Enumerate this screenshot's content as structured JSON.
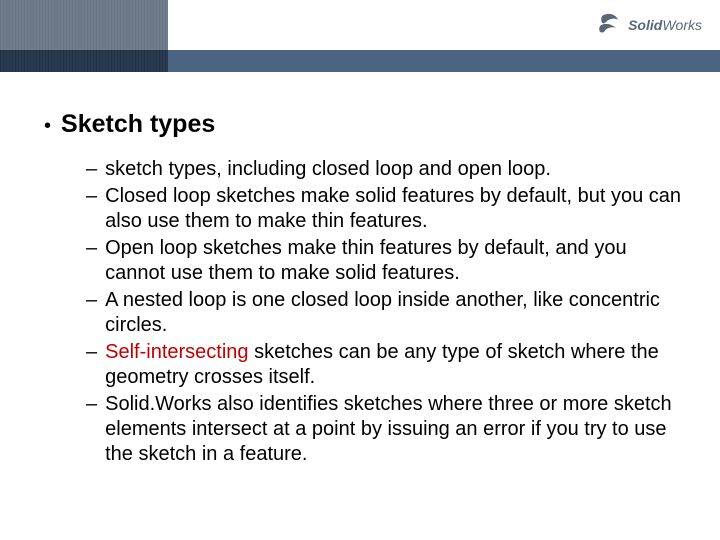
{
  "header": {
    "brand_prefix": "Solid",
    "brand_suffix": "Works"
  },
  "content": {
    "title": "Sketch types",
    "items": [
      {
        "text": "sketch types, including closed loop and open loop."
      },
      {
        "text": "Closed loop sketches make solid features by default, but you can also use them to make thin features."
      },
      {
        "text": "Open loop sketches make thin features by default, and you cannot use them to make solid features."
      },
      {
        "text": "A nested loop is one closed loop inside another, like concentric circles."
      },
      {
        "highlight": "Self-intersecting",
        "rest": " sketches can be any type of sketch where the geometry crosses itself."
      },
      {
        "text": "Solid.Works also identifies sketches where three or more sketch elements intersect at a point by issuing an error if you try to use the sketch in a feature."
      }
    ]
  }
}
